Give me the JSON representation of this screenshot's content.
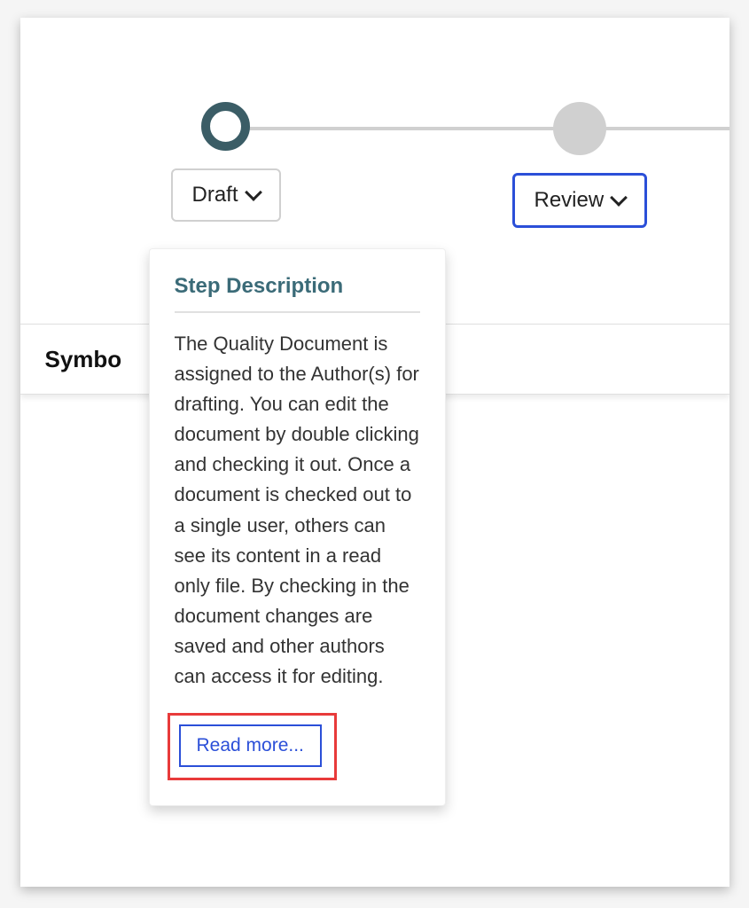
{
  "stepper": {
    "steps": [
      {
        "label": "Draft",
        "state": "outlined"
      },
      {
        "label": "Review",
        "state": "filled"
      }
    ]
  },
  "section": {
    "label": "Symbo"
  },
  "popover": {
    "title": "Step Description",
    "body": "The Quality Document is assigned to the Author(s) for drafting. You can edit the document by double clicking and checking it out. Once a document is checked out to a single user, others can see its content in a read only file. By checking in the document changes are saved and other authors can access it for editing.",
    "read_more": "Read more..."
  }
}
